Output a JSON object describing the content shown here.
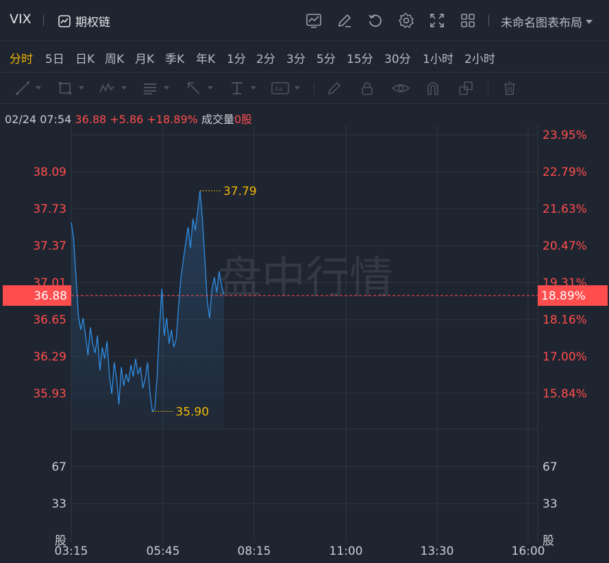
{
  "header": {
    "symbol": "VIX",
    "option_chain_label": "期权链",
    "layout_label": "未命名图表布局",
    "icons": [
      "chart-indicator-icon",
      "edit-icon",
      "refresh-icon",
      "gear-icon",
      "fullscreen-icon",
      "grid-layout-icon"
    ]
  },
  "periods": [
    {
      "label": "分时",
      "active": true
    },
    {
      "label": "5日",
      "active": false
    },
    {
      "label": "日K",
      "active": false
    },
    {
      "label": "周K",
      "active": false
    },
    {
      "label": "月K",
      "active": false
    },
    {
      "label": "季K",
      "active": false
    },
    {
      "label": "年K",
      "active": false
    },
    {
      "label": "1分",
      "active": false
    },
    {
      "label": "2分",
      "active": false
    },
    {
      "label": "3分",
      "active": false
    },
    {
      "label": "5分",
      "active": false
    },
    {
      "label": "15分",
      "active": false
    },
    {
      "label": "30分",
      "active": false
    },
    {
      "label": "1小时",
      "active": false
    },
    {
      "label": "2小时",
      "active": false
    }
  ],
  "drawing_tools": [
    "line-tool-icon",
    "rectangle-tool-icon",
    "wave-tool-icon",
    "text-block-tool-icon",
    "arrow-tool-icon",
    "measure-tool-icon",
    "label-tool-icon",
    "pen-icon",
    "lock-icon",
    "eye-icon",
    "magnet-icon",
    "layers-icon",
    "trash-icon"
  ],
  "info": {
    "datetime": "02/24 07:54",
    "price": "36.88",
    "change": "+5.86",
    "change_pct": "+18.89%",
    "volume_label": "成交量",
    "volume_value": "0股"
  },
  "watermark": "盘中行情",
  "colors": {
    "background": "#1f2530",
    "price_line": "#2f8fe6",
    "up": "#ff4d4d",
    "highlight": "#f2b705",
    "grid": "#2e3641"
  },
  "chart_data": {
    "type": "area",
    "x_ticks": [
      "03:15",
      "05:45",
      "08:15",
      "11:00",
      "13:30",
      "16:00"
    ],
    "x_range_minutes": [
      195,
      960
    ],
    "ylim": [
      35.75,
      38.27
    ],
    "y_ticks_left": [
      "38.09",
      "37.73",
      "37.37",
      "37.01",
      "36.65",
      "36.29",
      "35.93"
    ],
    "y_ticks_right": [
      "23.95%",
      "22.79%",
      "21.63%",
      "20.47%",
      "19.31%",
      "18.16%",
      "17.00%",
      "15.84%"
    ],
    "current_price": "36.88",
    "current_pct": "18.89%",
    "high_label": "37.79",
    "low_label": "35.90",
    "volume_ticks": [
      "67",
      "33",
      "股"
    ],
    "series": [
      {
        "x": [
          195,
          199,
          203,
          207,
          211,
          215,
          219,
          223,
          227,
          231,
          235,
          239,
          243,
          247,
          251,
          255,
          259,
          263,
          267,
          271,
          275,
          279,
          283,
          287,
          291,
          295,
          299,
          303,
          307,
          311,
          315,
          319,
          323,
          327,
          331,
          335,
          339,
          343,
          347,
          351,
          355,
          359,
          363,
          367,
          371,
          375,
          379,
          383,
          387,
          391,
          395,
          399,
          403,
          407,
          411,
          415,
          419,
          423,
          427,
          431,
          435,
          439,
          443,
          447,
          451
        ],
        "y": [
          37.52,
          37.38,
          37.05,
          36.72,
          36.6,
          36.7,
          36.55,
          36.38,
          36.62,
          36.48,
          36.4,
          36.55,
          36.25,
          36.45,
          36.35,
          36.5,
          36.2,
          36.05,
          36.32,
          36.18,
          35.96,
          36.28,
          36.12,
          36.22,
          36.15,
          36.3,
          36.2,
          36.35,
          36.22,
          36.28,
          36.1,
          36.18,
          36.32,
          36.06,
          35.9,
          35.92,
          36.2,
          36.62,
          36.95,
          36.55,
          36.7,
          36.48,
          36.6,
          36.45,
          36.52,
          36.8,
          37.05,
          37.2,
          37.35,
          37.48,
          37.3,
          37.55,
          37.45,
          37.62,
          37.79,
          37.55,
          37.2,
          36.85,
          36.7,
          36.95,
          37.05,
          36.92,
          37.1,
          36.98,
          36.9
        ]
      }
    ]
  }
}
